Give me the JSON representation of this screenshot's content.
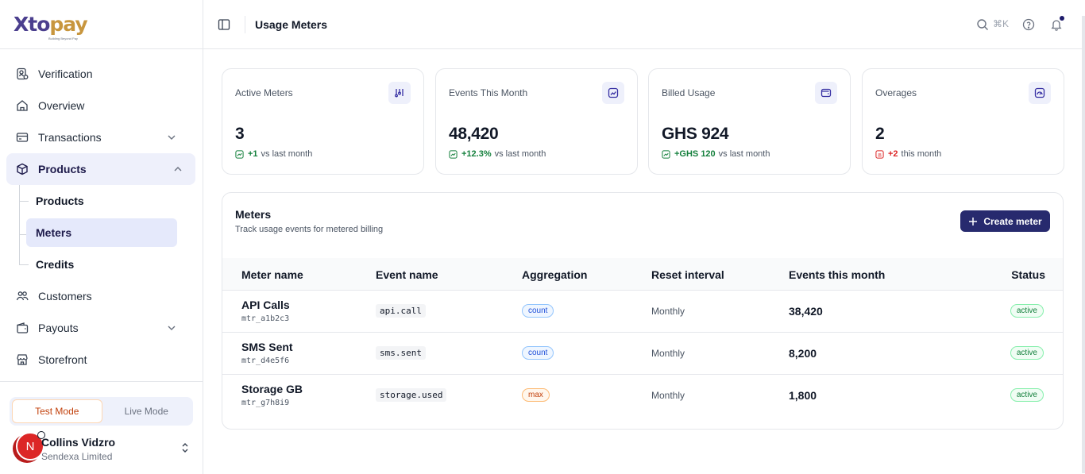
{
  "brand": {
    "name_part1": "Xto",
    "name_part2": "pay",
    "tagline": "Building Beyond Pay"
  },
  "sidebar": {
    "items": [
      {
        "label": "Verification",
        "icon": "verification-icon"
      },
      {
        "label": "Overview",
        "icon": "home-icon"
      },
      {
        "label": "Transactions",
        "icon": "card-icon",
        "expandable": true
      },
      {
        "label": "Products",
        "icon": "box-icon",
        "expanded": true,
        "active": true
      },
      {
        "label": "Customers",
        "icon": "users-icon"
      },
      {
        "label": "Payouts",
        "icon": "wallet-icon",
        "expandable": true
      },
      {
        "label": "Storefront",
        "icon": "store-icon"
      }
    ],
    "products_sub": [
      {
        "label": "Products"
      },
      {
        "label": "Meters",
        "active": true
      },
      {
        "label": "Credits"
      }
    ],
    "mode": {
      "test": "Test Mode",
      "live": "Live Mode",
      "selected": "Test Mode"
    },
    "user": {
      "initial": "N",
      "name": "Collins Vidzro",
      "org": "Sendexa Limited"
    }
  },
  "header": {
    "title": "Usage Meters",
    "shortcut": "⌘K"
  },
  "stats": [
    {
      "label": "Active Meters",
      "value": "3",
      "delta": "+1",
      "delta_text": "vs last month",
      "trend": "up",
      "icon": "meter-icon"
    },
    {
      "label": "Events This Month",
      "value": "48,420",
      "delta": "+12.3%",
      "delta_text": "vs last month",
      "trend": "up",
      "icon": "chart-icon"
    },
    {
      "label": "Billed Usage",
      "value": "GHS 924",
      "delta": "+GHS 120",
      "delta_text": "vs last month",
      "trend": "up",
      "icon": "wallet-icon"
    },
    {
      "label": "Overages",
      "value": "2",
      "delta": "+2",
      "delta_text": "this month",
      "trend": "down",
      "icon": "gauge-icon"
    }
  ],
  "meters": {
    "title": "Meters",
    "subtitle": "Track usage events for metered billing",
    "create_label": "Create meter",
    "columns": [
      "Meter name",
      "Event name",
      "Aggregation",
      "Reset interval",
      "Events this month",
      "Status"
    ],
    "rows": [
      {
        "name": "API Calls",
        "id": "mtr_a1b2c3",
        "event": "api.call",
        "aggregation": "count",
        "interval": "Monthly",
        "events": "38,420",
        "status": "active"
      },
      {
        "name": "SMS Sent",
        "id": "mtr_d4e5f6",
        "event": "sms.sent",
        "aggregation": "count",
        "interval": "Monthly",
        "events": "8,200",
        "status": "active"
      },
      {
        "name": "Storage GB",
        "id": "mtr_g7h8i9",
        "event": "storage.used",
        "aggregation": "max",
        "interval": "Monthly",
        "events": "1,800",
        "status": "active"
      }
    ]
  },
  "colors": {
    "accent": "#272a6e",
    "positive": "#15803d",
    "negative": "#dc2626",
    "brand": "#4b3f8e"
  }
}
